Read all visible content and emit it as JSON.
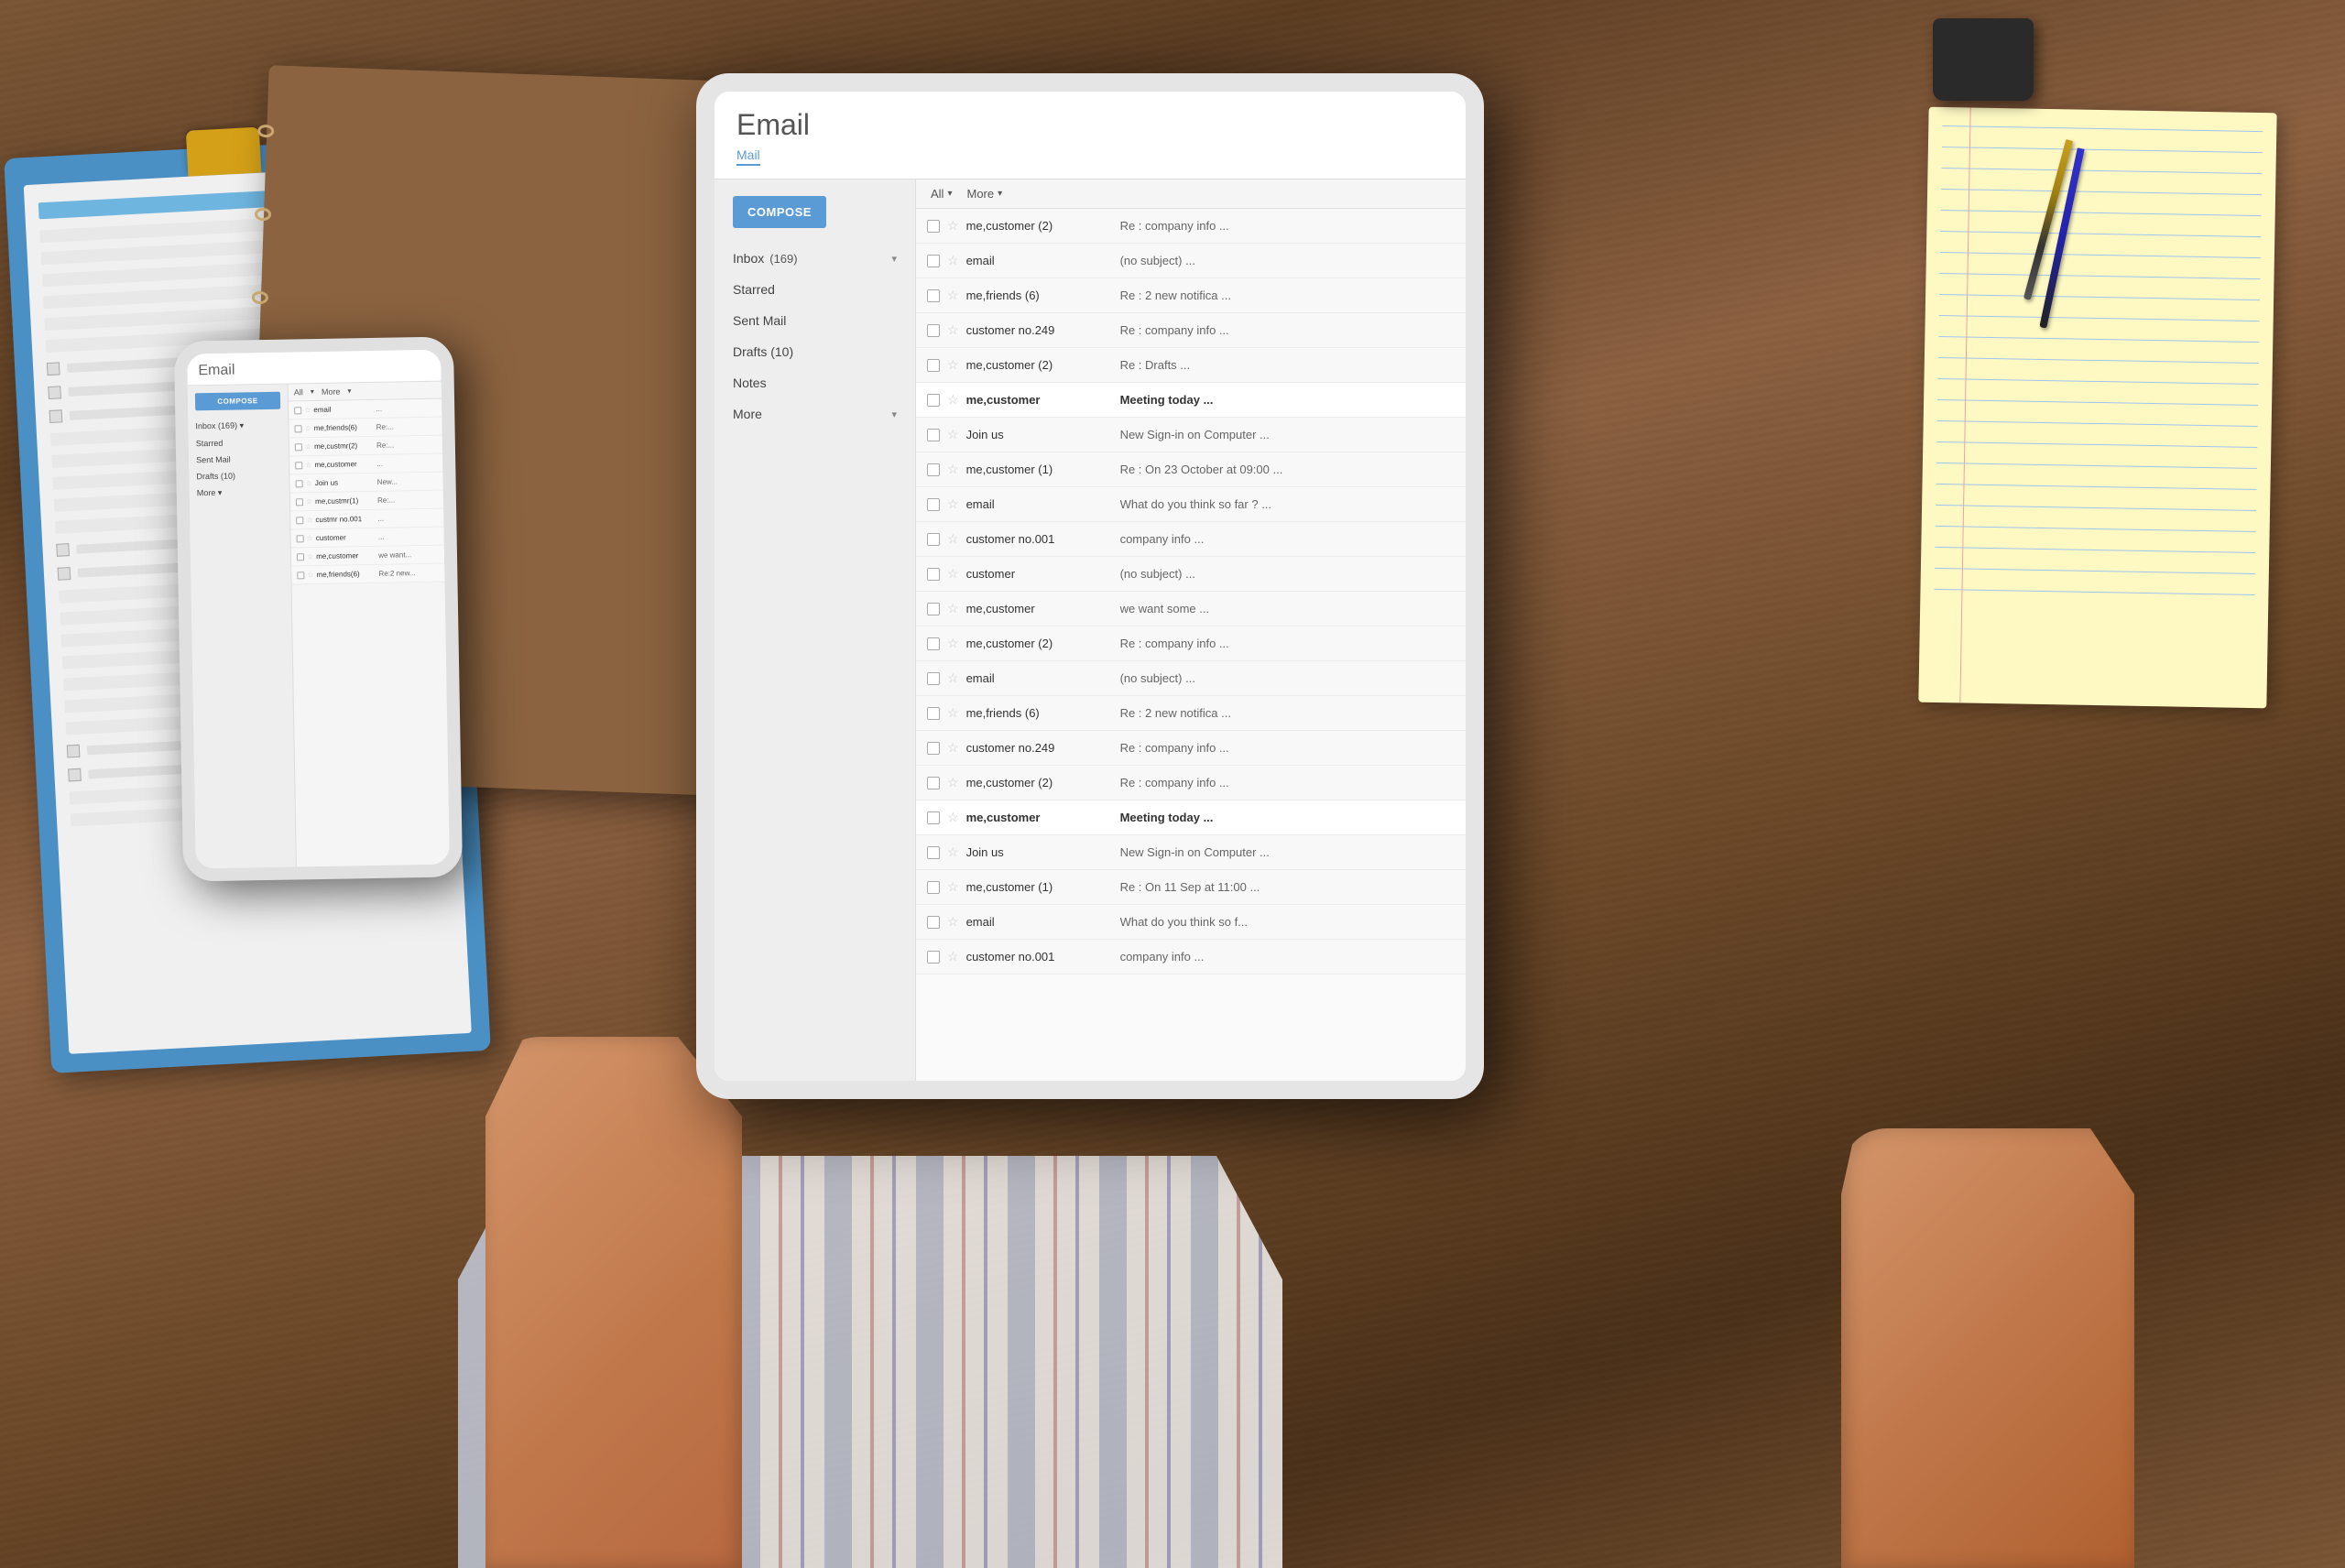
{
  "background": {
    "color": "#5a3d25"
  },
  "app": {
    "title": "Email"
  },
  "tablet": {
    "header": {
      "title": "Email"
    },
    "nav": {
      "mail_label": "Mail",
      "all_filter": "All",
      "more_filter": "More"
    },
    "sidebar": {
      "compose_label": "COMPOSE",
      "items": [
        {
          "label": "Inbox",
          "count": "(169)",
          "has_chevron": true
        },
        {
          "label": "Starred",
          "count": "",
          "has_chevron": false
        },
        {
          "label": "Sent Mail",
          "count": "",
          "has_chevron": false
        },
        {
          "label": "Drafts",
          "count": "(10)",
          "has_chevron": false
        },
        {
          "label": "Notes",
          "count": "",
          "has_chevron": false
        },
        {
          "label": "More",
          "count": "",
          "has_chevron": true
        }
      ]
    },
    "emails": [
      {
        "sender": "me,customer (2)",
        "subject": "Re : company info ...",
        "read": false
      },
      {
        "sender": "email",
        "subject": "(no subject) ...",
        "read": true
      },
      {
        "sender": "me,friends (6)",
        "subject": "Re : 2 new notifica ...",
        "read": true
      },
      {
        "sender": "customer no.249",
        "subject": "Re : company info ...",
        "read": true
      },
      {
        "sender": "me,customer (2)",
        "subject": "Re : Drafts ...",
        "read": true
      },
      {
        "sender": "me,customer",
        "subject": "Meeting today ...",
        "read": false
      },
      {
        "sender": "Join us",
        "subject": "New Sign-in on Computer ...",
        "read": true
      },
      {
        "sender": "me,customer (1)",
        "subject": "Re : On 23 October at 09:00 ...",
        "read": true
      },
      {
        "sender": "email",
        "subject": "What do you think so far ? ...",
        "read": true
      },
      {
        "sender": "customer no.001",
        "subject": "company info ...",
        "read": true
      },
      {
        "sender": "customer",
        "subject": "(no subject) ...",
        "read": true
      },
      {
        "sender": "me,customer",
        "subject": "we want some ...",
        "read": true
      },
      {
        "sender": "me,customer (2)",
        "subject": "Re : company info ...",
        "read": false
      },
      {
        "sender": "email",
        "subject": "(no subject) ...",
        "read": true
      },
      {
        "sender": "me,friends (6)",
        "subject": "Re : 2 new notifica ...",
        "read": true
      },
      {
        "sender": "customer no.249",
        "subject": "Re : company info ...",
        "read": true
      },
      {
        "sender": "me,customer (2)",
        "subject": "Re : company info ...",
        "read": true
      },
      {
        "sender": "me,customer",
        "subject": "Meeting today ...",
        "read": false
      },
      {
        "sender": "Join us",
        "subject": "New Sign-in on Computer ...",
        "read": true
      },
      {
        "sender": "me,customer (1)",
        "subject": "Re : On 11 Sep at 11:00 ...",
        "read": true
      },
      {
        "sender": "email",
        "subject": "What do you think so f...",
        "read": true
      },
      {
        "sender": "customer no.001",
        "subject": "company info ...",
        "read": true
      }
    ]
  },
  "phone": {
    "header": {
      "title": "Email"
    },
    "sidebar": {
      "compose_label": "COMPOSE",
      "items": [
        {
          "label": "Inbox (169)"
        },
        {
          "label": "Starred"
        },
        {
          "label": "Sent Mail"
        },
        {
          "label": "Drafts (10)"
        },
        {
          "label": "More"
        }
      ]
    },
    "toolbar": {
      "all": "All",
      "more": "More"
    },
    "emails": [
      {
        "sender": "email",
        "subject": "..."
      },
      {
        "sender": "me, friends (6)",
        "subject": "Re : ..."
      },
      {
        "sender": "me, customer (2)",
        "subject": "Re : ..."
      },
      {
        "sender": "me, customer",
        "subject": "..."
      },
      {
        "sender": "Join us",
        "subject": "New ..."
      },
      {
        "sender": "me, customer (1)",
        "subject": "Re : ..."
      },
      {
        "sender": "customer no.001",
        "subject": "..."
      },
      {
        "sender": "customer",
        "subject": "..."
      },
      {
        "sender": "me, customer",
        "subject": "..."
      },
      {
        "sender": "me,friends (6)",
        "subject": "Re : ..."
      }
    ]
  }
}
